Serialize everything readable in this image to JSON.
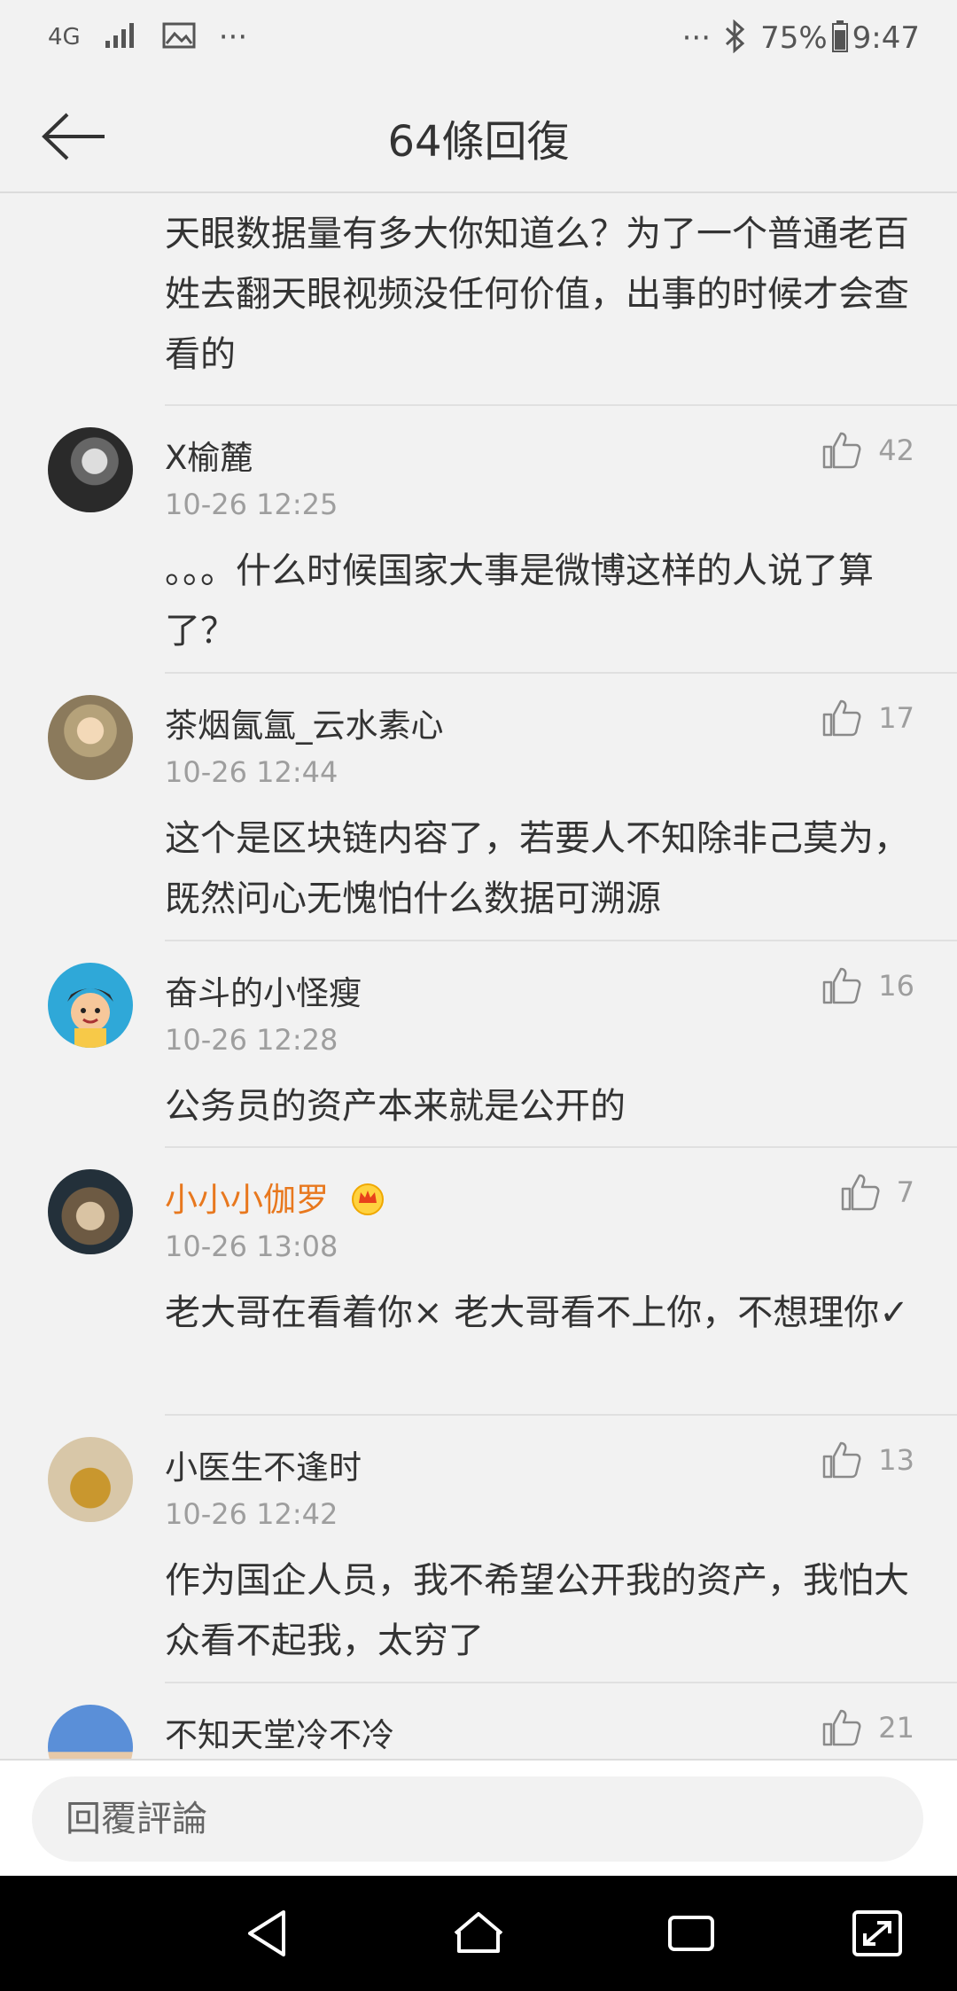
{
  "status_bar": {
    "network": "4G",
    "more_left": "···",
    "more_right": "···",
    "battery": "75%",
    "time": "9:47"
  },
  "header": {
    "title": "64條回復"
  },
  "comments": [
    {
      "body": "天眼数据量有多大你知道么？为了一个普通老百姓去翻天眼视频没任何价值，出事的时候才会查看的"
    },
    {
      "username": "X榆麓",
      "time": "10-26 12:25",
      "likes": "42",
      "body": "。。。什么时候国家大事是微博这样的人说了算了？"
    },
    {
      "username": "茶烟氤氲_云水素心",
      "time": "10-26 12:44",
      "likes": "17",
      "body": "这个是区块链内容了，若要人不知除非己莫为，既然问心无愧怕什么数据可溯源"
    },
    {
      "username": "奋斗的小怪瘦",
      "time": "10-26 12:28",
      "likes": "16",
      "body": "公务员的资产本来就是公开的"
    },
    {
      "username": "小小小伽罗",
      "time": "10-26 13:08",
      "likes": "7",
      "body": "老大哥在看着你× 老大哥看不上你，不想理你✓"
    },
    {
      "username": "小医生不逢时",
      "time": "10-26 12:42",
      "likes": "13",
      "body": "作为国企人员，我不希望公开我的资产，我怕大众看不起我，太穷了"
    },
    {
      "username": "不知天堂冷不冷",
      "likes": "21"
    }
  ],
  "input": {
    "placeholder": "回覆評論"
  },
  "colors": {
    "vip_name": "#e8781e",
    "background": "#f2f2f2",
    "secondary_text": "#9e9e9e"
  }
}
